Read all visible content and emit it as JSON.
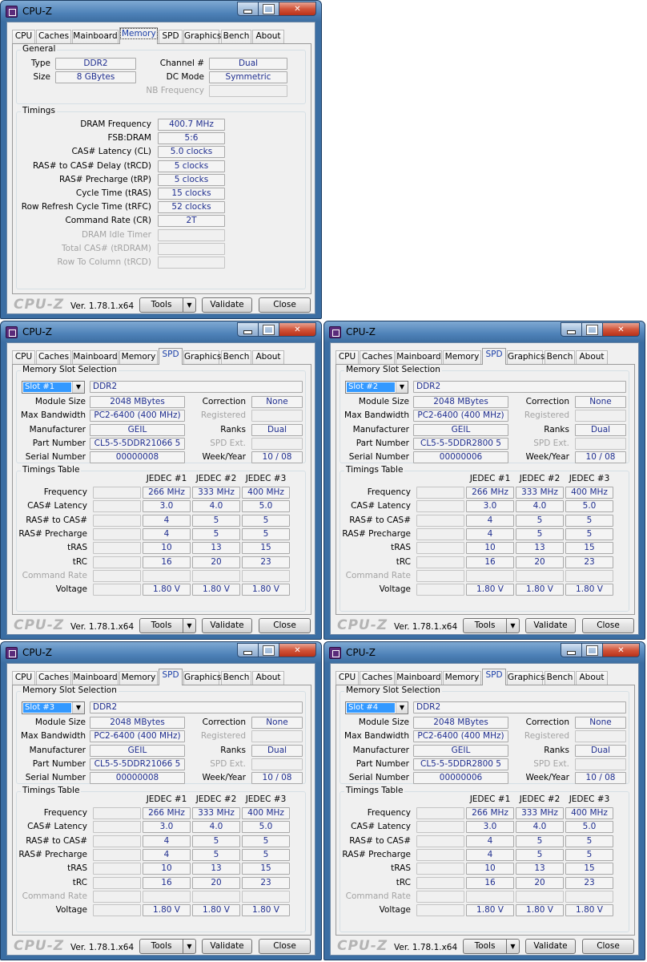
{
  "windows": [
    {
      "title": "CPU-Z",
      "tabs": [
        {
          "label": "CPU"
        },
        {
          "label": "Caches"
        },
        {
          "label": "Mainboard"
        },
        {
          "label": "Memory"
        },
        {
          "label": "SPD"
        },
        {
          "label": "Graphics"
        },
        {
          "label": "Bench"
        },
        {
          "label": "About"
        }
      ],
      "active_tab": "Memory",
      "memory": {
        "general_title": "General",
        "type_label": "Type",
        "type_value": "DDR2",
        "size_label": "Size",
        "size_value": "8 GBytes",
        "channel_label": "Channel #",
        "channel_value": "Dual",
        "dcmode_label": "DC Mode",
        "dcmode_value": "Symmetric",
        "nbfreq_label": "NB Frequency",
        "nbfreq_value": "",
        "timings_title": "Timings",
        "timings": [
          {
            "label": "DRAM Frequency",
            "value": "400.7 MHz",
            "disabled": false
          },
          {
            "label": "FSB:DRAM",
            "value": "5:6",
            "disabled": false
          },
          {
            "label": "CAS# Latency (CL)",
            "value": "5.0 clocks",
            "disabled": false
          },
          {
            "label": "RAS# to CAS# Delay (tRCD)",
            "value": "5 clocks",
            "disabled": false
          },
          {
            "label": "RAS# Precharge (tRP)",
            "value": "5 clocks",
            "disabled": false
          },
          {
            "label": "Cycle Time (tRAS)",
            "value": "15 clocks",
            "disabled": false
          },
          {
            "label": "Row Refresh Cycle Time (tRFC)",
            "value": "52 clocks",
            "disabled": false
          },
          {
            "label": "Command Rate (CR)",
            "value": "2T",
            "disabled": false
          },
          {
            "label": "DRAM Idle Timer",
            "value": "",
            "disabled": true
          },
          {
            "label": "Total CAS# (tRDRAM)",
            "value": "",
            "disabled": true
          },
          {
            "label": "Row To Column (tRCD)",
            "value": "",
            "disabled": true
          }
        ]
      },
      "footer": {
        "logo": "CPU-Z",
        "version": "Ver. 1.78.1.x64",
        "tools": "Tools",
        "tools_arrow": "▼",
        "validate": "Validate",
        "close": "Close"
      }
    },
    {
      "title": "CPU-Z",
      "tabs": [
        {
          "label": "CPU"
        },
        {
          "label": "Caches"
        },
        {
          "label": "Mainboard"
        },
        {
          "label": "Memory"
        },
        {
          "label": "SPD"
        },
        {
          "label": "Graphics"
        },
        {
          "label": "Bench"
        },
        {
          "label": "About"
        }
      ],
      "active_tab": "SPD",
      "spd": {
        "slot_group_title": "Memory Slot Selection",
        "slot": "Slot #1",
        "mem_type": "DDR2",
        "module_size_label": "Module Size",
        "module_size": "2048 MBytes",
        "max_bw_label": "Max Bandwidth",
        "max_bw": "PC2-6400 (400 MHz)",
        "manufacturer_label": "Manufacturer",
        "manufacturer": "GEIL",
        "part_label": "Part Number",
        "part": "CL5-5-5DDR21066 5",
        "serial_label": "Serial Number",
        "serial": "00000008",
        "correction_label": "Correction",
        "correction": "None",
        "registered_label": "Registered",
        "registered": "",
        "ranks_label": "Ranks",
        "ranks": "Dual",
        "spdext_label": "SPD Ext.",
        "spdext": "",
        "week_label": "Week/Year",
        "week": "10 / 08",
        "timings_title": "Timings Table",
        "columns": [
          "JEDEC #1",
          "JEDEC #2",
          "JEDEC #3"
        ],
        "rows": [
          {
            "label": "Frequency",
            "values": [
              "266 MHz",
              "333 MHz",
              "400 MHz"
            ],
            "disabled": false
          },
          {
            "label": "CAS# Latency",
            "values": [
              "3.0",
              "4.0",
              "5.0"
            ],
            "disabled": false
          },
          {
            "label": "RAS# to CAS#",
            "values": [
              "4",
              "5",
              "5"
            ],
            "disabled": false
          },
          {
            "label": "RAS# Precharge",
            "values": [
              "4",
              "5",
              "5"
            ],
            "disabled": false
          },
          {
            "label": "tRAS",
            "values": [
              "10",
              "13",
              "15"
            ],
            "disabled": false
          },
          {
            "label": "tRC",
            "values": [
              "16",
              "20",
              "23"
            ],
            "disabled": false
          },
          {
            "label": "Command Rate",
            "values": [
              "",
              "",
              ""
            ],
            "disabled": true
          },
          {
            "label": "Voltage",
            "values": [
              "1.80 V",
              "1.80 V",
              "1.80 V"
            ],
            "disabled": false
          }
        ]
      },
      "footer": {
        "logo": "CPU-Z",
        "version": "Ver. 1.78.1.x64",
        "tools": "Tools",
        "tools_arrow": "▼",
        "validate": "Validate",
        "close": "Close"
      }
    },
    {
      "title": "CPU-Z",
      "tabs": [
        {
          "label": "CPU"
        },
        {
          "label": "Caches"
        },
        {
          "label": "Mainboard"
        },
        {
          "label": "Memory"
        },
        {
          "label": "SPD"
        },
        {
          "label": "Graphics"
        },
        {
          "label": "Bench"
        },
        {
          "label": "About"
        }
      ],
      "active_tab": "SPD",
      "spd": {
        "slot_group_title": "Memory Slot Selection",
        "slot": "Slot #2",
        "mem_type": "DDR2",
        "module_size_label": "Module Size",
        "module_size": "2048 MBytes",
        "max_bw_label": "Max Bandwidth",
        "max_bw": "PC2-6400 (400 MHz)",
        "manufacturer_label": "Manufacturer",
        "manufacturer": "GEIL",
        "part_label": "Part Number",
        "part": "CL5-5-5DDR2800 5",
        "serial_label": "Serial Number",
        "serial": "00000006",
        "correction_label": "Correction",
        "correction": "None",
        "registered_label": "Registered",
        "registered": "",
        "ranks_label": "Ranks",
        "ranks": "Dual",
        "spdext_label": "SPD Ext.",
        "spdext": "",
        "week_label": "Week/Year",
        "week": "10 / 08",
        "timings_title": "Timings Table",
        "columns": [
          "JEDEC #1",
          "JEDEC #2",
          "JEDEC #3"
        ],
        "rows": [
          {
            "label": "Frequency",
            "values": [
              "266 MHz",
              "333 MHz",
              "400 MHz"
            ],
            "disabled": false
          },
          {
            "label": "CAS# Latency",
            "values": [
              "3.0",
              "4.0",
              "5.0"
            ],
            "disabled": false
          },
          {
            "label": "RAS# to CAS#",
            "values": [
              "4",
              "5",
              "5"
            ],
            "disabled": false
          },
          {
            "label": "RAS# Precharge",
            "values": [
              "4",
              "5",
              "5"
            ],
            "disabled": false
          },
          {
            "label": "tRAS",
            "values": [
              "10",
              "13",
              "15"
            ],
            "disabled": false
          },
          {
            "label": "tRC",
            "values": [
              "16",
              "20",
              "23"
            ],
            "disabled": false
          },
          {
            "label": "Command Rate",
            "values": [
              "",
              "",
              ""
            ],
            "disabled": true
          },
          {
            "label": "Voltage",
            "values": [
              "1.80 V",
              "1.80 V",
              "1.80 V"
            ],
            "disabled": false
          }
        ]
      },
      "footer": {
        "logo": "CPU-Z",
        "version": "Ver. 1.78.1.x64",
        "tools": "Tools",
        "tools_arrow": "▼",
        "validate": "Validate",
        "close": "Close"
      }
    },
    {
      "title": "CPU-Z",
      "tabs": [
        {
          "label": "CPU"
        },
        {
          "label": "Caches"
        },
        {
          "label": "Mainboard"
        },
        {
          "label": "Memory"
        },
        {
          "label": "SPD"
        },
        {
          "label": "Graphics"
        },
        {
          "label": "Bench"
        },
        {
          "label": "About"
        }
      ],
      "active_tab": "SPD",
      "spd": {
        "slot_group_title": "Memory Slot Selection",
        "slot": "Slot #3",
        "mem_type": "DDR2",
        "module_size_label": "Module Size",
        "module_size": "2048 MBytes",
        "max_bw_label": "Max Bandwidth",
        "max_bw": "PC2-6400 (400 MHz)",
        "manufacturer_label": "Manufacturer",
        "manufacturer": "GEIL",
        "part_label": "Part Number",
        "part": "CL5-5-5DDR21066 5",
        "serial_label": "Serial Number",
        "serial": "00000008",
        "correction_label": "Correction",
        "correction": "None",
        "registered_label": "Registered",
        "registered": "",
        "ranks_label": "Ranks",
        "ranks": "Dual",
        "spdext_label": "SPD Ext.",
        "spdext": "",
        "week_label": "Week/Year",
        "week": "10 / 08",
        "timings_title": "Timings Table",
        "columns": [
          "JEDEC #1",
          "JEDEC #2",
          "JEDEC #3"
        ],
        "rows": [
          {
            "label": "Frequency",
            "values": [
              "266 MHz",
              "333 MHz",
              "400 MHz"
            ],
            "disabled": false
          },
          {
            "label": "CAS# Latency",
            "values": [
              "3.0",
              "4.0",
              "5.0"
            ],
            "disabled": false
          },
          {
            "label": "RAS# to CAS#",
            "values": [
              "4",
              "5",
              "5"
            ],
            "disabled": false
          },
          {
            "label": "RAS# Precharge",
            "values": [
              "4",
              "5",
              "5"
            ],
            "disabled": false
          },
          {
            "label": "tRAS",
            "values": [
              "10",
              "13",
              "15"
            ],
            "disabled": false
          },
          {
            "label": "tRC",
            "values": [
              "16",
              "20",
              "23"
            ],
            "disabled": false
          },
          {
            "label": "Command Rate",
            "values": [
              "",
              "",
              ""
            ],
            "disabled": true
          },
          {
            "label": "Voltage",
            "values": [
              "1.80 V",
              "1.80 V",
              "1.80 V"
            ],
            "disabled": false
          }
        ]
      },
      "footer": {
        "logo": "CPU-Z",
        "version": "Ver. 1.78.1.x64",
        "tools": "Tools",
        "tools_arrow": "▼",
        "validate": "Validate",
        "close": "Close"
      }
    },
    {
      "title": "CPU-Z",
      "tabs": [
        {
          "label": "CPU"
        },
        {
          "label": "Caches"
        },
        {
          "label": "Mainboard"
        },
        {
          "label": "Memory"
        },
        {
          "label": "SPD"
        },
        {
          "label": "Graphics"
        },
        {
          "label": "Bench"
        },
        {
          "label": "About"
        }
      ],
      "active_tab": "SPD",
      "spd": {
        "slot_group_title": "Memory Slot Selection",
        "slot": "Slot #4",
        "mem_type": "DDR2",
        "module_size_label": "Module Size",
        "module_size": "2048 MBytes",
        "max_bw_label": "Max Bandwidth",
        "max_bw": "PC2-6400 (400 MHz)",
        "manufacturer_label": "Manufacturer",
        "manufacturer": "GEIL",
        "part_label": "Part Number",
        "part": "CL5-5-5DDR2800 5",
        "serial_label": "Serial Number",
        "serial": "00000006",
        "correction_label": "Correction",
        "correction": "None",
        "registered_label": "Registered",
        "registered": "",
        "ranks_label": "Ranks",
        "ranks": "Dual",
        "spdext_label": "SPD Ext.",
        "spdext": "",
        "week_label": "Week/Year",
        "week": "10 / 08",
        "timings_title": "Timings Table",
        "columns": [
          "JEDEC #1",
          "JEDEC #2",
          "JEDEC #3"
        ],
        "rows": [
          {
            "label": "Frequency",
            "values": [
              "266 MHz",
              "333 MHz",
              "400 MHz"
            ],
            "disabled": false
          },
          {
            "label": "CAS# Latency",
            "values": [
              "3.0",
              "4.0",
              "5.0"
            ],
            "disabled": false
          },
          {
            "label": "RAS# to CAS#",
            "values": [
              "4",
              "5",
              "5"
            ],
            "disabled": false
          },
          {
            "label": "RAS# Precharge",
            "values": [
              "4",
              "5",
              "5"
            ],
            "disabled": false
          },
          {
            "label": "tRAS",
            "values": [
              "10",
              "13",
              "15"
            ],
            "disabled": false
          },
          {
            "label": "tRC",
            "values": [
              "16",
              "20",
              "23"
            ],
            "disabled": false
          },
          {
            "label": "Command Rate",
            "values": [
              "",
              "",
              ""
            ],
            "disabled": true
          },
          {
            "label": "Voltage",
            "values": [
              "1.80 V",
              "1.80 V",
              "1.80 V"
            ],
            "disabled": false
          }
        ]
      },
      "footer": {
        "logo": "CPU-Z",
        "version": "Ver. 1.78.1.x64",
        "tools": "Tools",
        "tools_arrow": "▼",
        "validate": "Validate",
        "close": "Close"
      }
    }
  ]
}
